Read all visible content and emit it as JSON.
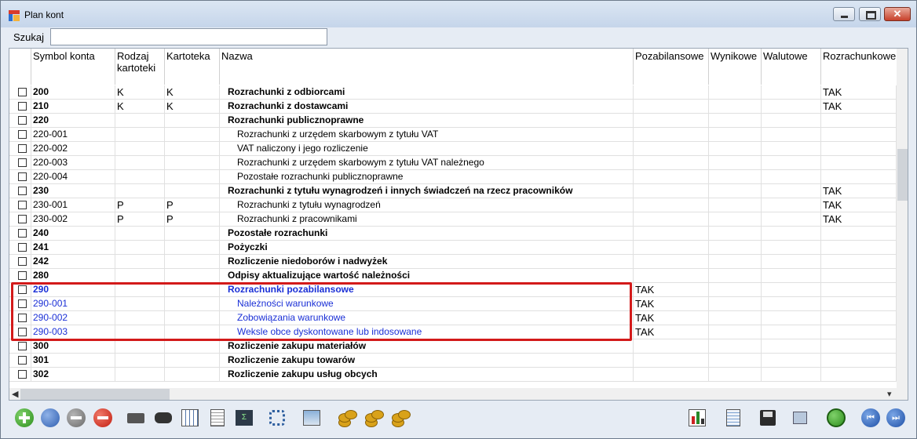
{
  "window": {
    "title": "Plan kont"
  },
  "search": {
    "label": "Szukaj",
    "value": ""
  },
  "columns": {
    "symbol": "Symbol konta",
    "rodzaj_line1": "Rodzaj",
    "rodzaj_line2": "kartoteki",
    "kartoteka": "Kartoteka",
    "nazwa": "Nazwa",
    "pozabilansowe": "Pozabilansowe",
    "wynikowe": "Wynikowe",
    "walutowe": "Walutowe",
    "rozrachunkowe": "Rozrachunkowe"
  },
  "rows": [
    {
      "symbol": "200",
      "rodzaj": "K",
      "kartoteka": "K",
      "nazwa": "Rozrachunki z odbiorcami",
      "pozabilansowe": "",
      "rozrachunkowe": "TAK"
    },
    {
      "symbol": "210",
      "rodzaj": "K",
      "kartoteka": "K",
      "nazwa": "Rozrachunki z dostawcami",
      "pozabilansowe": "",
      "rozrachunkowe": "TAK"
    },
    {
      "symbol": "220",
      "rodzaj": "",
      "kartoteka": "",
      "nazwa": "Rozrachunki publicznoprawne",
      "pozabilansowe": "",
      "rozrachunkowe": ""
    },
    {
      "symbol": "220-001",
      "rodzaj": "",
      "kartoteka": "",
      "nazwa": "Rozrachunki z urzędem skarbowym z tytułu VAT",
      "pozabilansowe": "",
      "rozrachunkowe": ""
    },
    {
      "symbol": "220-002",
      "rodzaj": "",
      "kartoteka": "",
      "nazwa": "VAT naliczony i jego rozliczenie",
      "pozabilansowe": "",
      "rozrachunkowe": ""
    },
    {
      "symbol": "220-003",
      "rodzaj": "",
      "kartoteka": "",
      "nazwa": "Rozrachunki z urzędem skarbowym z tytułu VAT należnego",
      "pozabilansowe": "",
      "rozrachunkowe": ""
    },
    {
      "symbol": "220-004",
      "rodzaj": "",
      "kartoteka": "",
      "nazwa": "Pozostałe rozrachunki publicznoprawne",
      "pozabilansowe": "",
      "rozrachunkowe": ""
    },
    {
      "symbol": "230",
      "rodzaj": "",
      "kartoteka": "",
      "nazwa": "Rozrachunki z tytułu wynagrodzeń i innych świadczeń na rzecz pracowników",
      "pozabilansowe": "",
      "rozrachunkowe": "TAK"
    },
    {
      "symbol": "230-001",
      "rodzaj": "P",
      "kartoteka": "P",
      "nazwa": "Rozrachunki z tytułu wynagrodzeń",
      "pozabilansowe": "",
      "rozrachunkowe": "TAK"
    },
    {
      "symbol": "230-002",
      "rodzaj": "P",
      "kartoteka": "P",
      "nazwa": "Rozrachunki z pracownikami",
      "pozabilansowe": "",
      "rozrachunkowe": "TAK"
    },
    {
      "symbol": "240",
      "rodzaj": "",
      "kartoteka": "",
      "nazwa": "Pozostałe rozrachunki",
      "pozabilansowe": "",
      "rozrachunkowe": ""
    },
    {
      "symbol": "241",
      "rodzaj": "",
      "kartoteka": "",
      "nazwa": "Pożyczki",
      "pozabilansowe": "",
      "rozrachunkowe": ""
    },
    {
      "symbol": "242",
      "rodzaj": "",
      "kartoteka": "",
      "nazwa": "Rozliczenie niedoborów i nadwyżek",
      "pozabilansowe": "",
      "rozrachunkowe": ""
    },
    {
      "symbol": "280",
      "rodzaj": "",
      "kartoteka": "",
      "nazwa": "Odpisy aktualizujące wartość należności",
      "pozabilansowe": "",
      "rozrachunkowe": ""
    },
    {
      "symbol": "290",
      "rodzaj": "",
      "kartoteka": "",
      "nazwa": "Rozrachunki pozabilansowe",
      "pozabilansowe": "TAK",
      "rozrachunkowe": ""
    },
    {
      "symbol": "290-001",
      "rodzaj": "",
      "kartoteka": "",
      "nazwa": "Należności warunkowe",
      "pozabilansowe": "TAK",
      "rozrachunkowe": ""
    },
    {
      "symbol": "290-002",
      "rodzaj": "",
      "kartoteka": "",
      "nazwa": "Zobowiązania warunkowe",
      "pozabilansowe": "TAK",
      "rozrachunkowe": ""
    },
    {
      "symbol": "290-003",
      "rodzaj": "",
      "kartoteka": "",
      "nazwa": "Weksle obce dyskontowane lub indosowane",
      "pozabilansowe": "TAK",
      "rozrachunkowe": ""
    },
    {
      "symbol": "300",
      "rodzaj": "",
      "kartoteka": "",
      "nazwa": "Rozliczenie zakupu materiałów",
      "pozabilansowe": "",
      "rozrachunkowe": ""
    },
    {
      "symbol": "301",
      "rodzaj": "",
      "kartoteka": "",
      "nazwa": "Rozliczenie zakupu towarów",
      "pozabilansowe": "",
      "rozrachunkowe": ""
    },
    {
      "symbol": "302",
      "rodzaj": "",
      "kartoteka": "",
      "nazwa": "Rozliczenie zakupu usług obcych",
      "pozabilansowe": "",
      "rozrachunkowe": ""
    }
  ],
  "colors": {
    "highlight": "#d31a1a",
    "pozabilansowe_text": "#1a2fd6"
  },
  "icons": {
    "left": [
      "add-icon",
      "preview-icon",
      "remove-icon",
      "no-entry-icon",
      "print-icon",
      "binoculars-icon",
      "table-icon",
      "newspaper-icon",
      "calculator-icon",
      "hierarchy-icon",
      "window-chart-icon",
      "coins-icon",
      "coins-icon",
      "coins-icon"
    ],
    "right": [
      "bar-chart-icon",
      "spreadsheet-icon",
      "save-icon",
      "windows-icon",
      "refresh-icon",
      "first-icon",
      "last-icon"
    ]
  }
}
